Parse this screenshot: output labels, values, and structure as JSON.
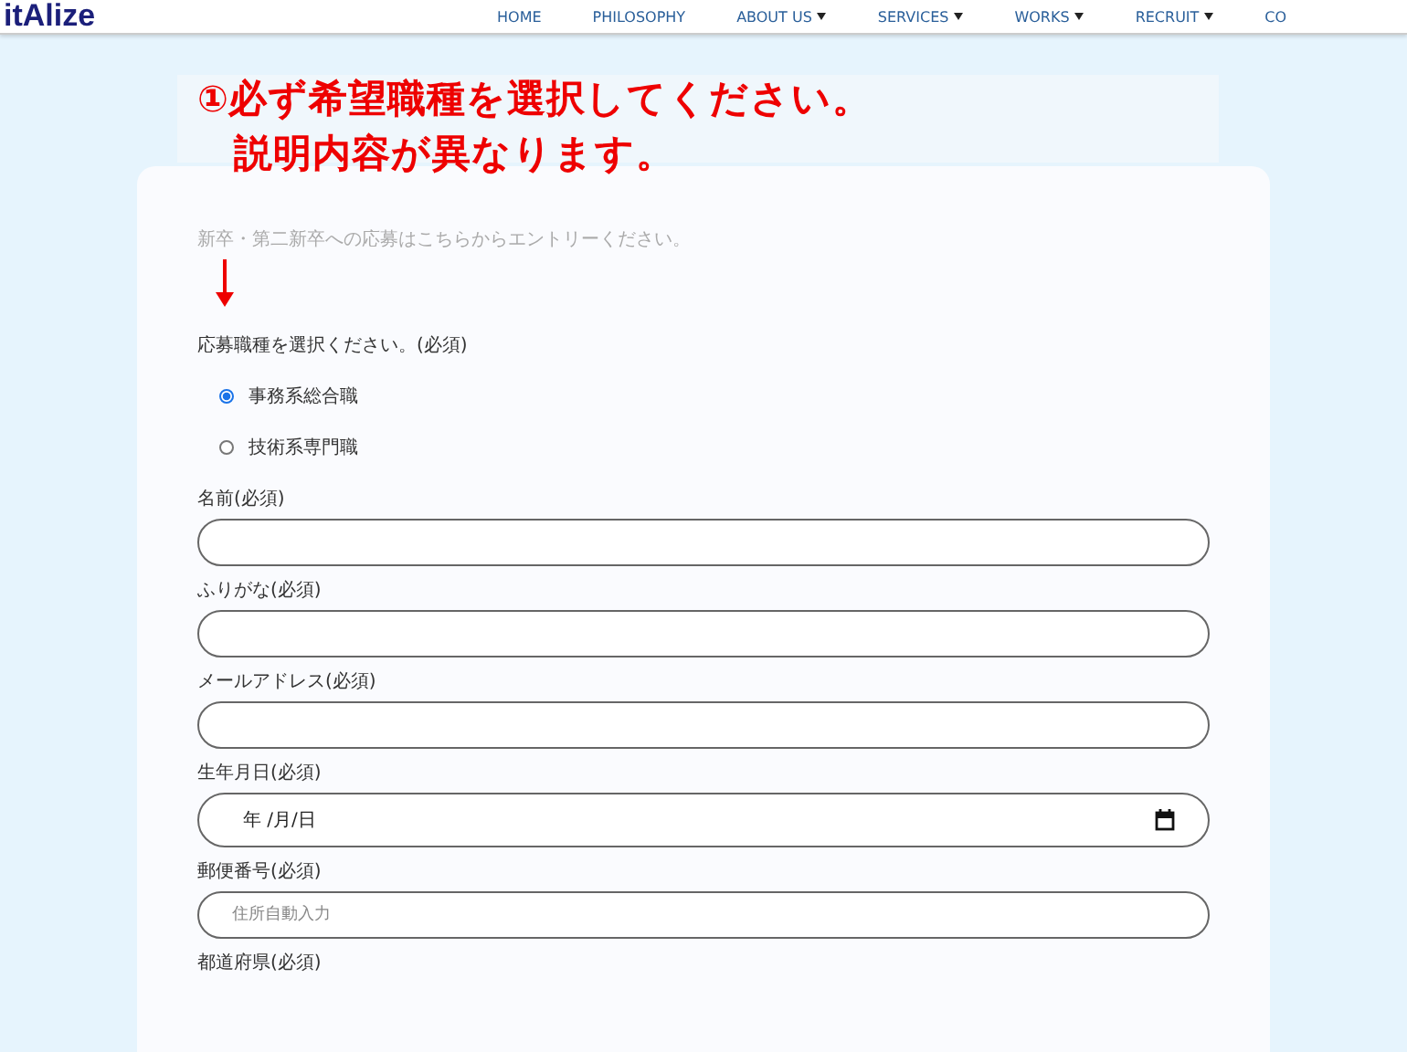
{
  "header": {
    "logo": "itAlize",
    "nav": [
      {
        "label": "HOME",
        "dropdown": false
      },
      {
        "label": "PHILOSOPHY",
        "dropdown": false
      },
      {
        "label": "ABOUT US",
        "dropdown": true
      },
      {
        "label": "SERVICES",
        "dropdown": true
      },
      {
        "label": "WORKS",
        "dropdown": true
      },
      {
        "label": "RECRUIT",
        "dropdown": true
      },
      {
        "label": "CO",
        "dropdown": false
      }
    ]
  },
  "annotation": {
    "number": "①",
    "lines": [
      "必ず希望職種を選択してください。",
      "説明内容が異なります。"
    ]
  },
  "form": {
    "intro": "新卒・第二新卒への応募はこちらからエントリーください。",
    "job_question": "応募職種を選択ください。(必須)",
    "job_options": [
      {
        "label": "事務系総合職",
        "selected": true
      },
      {
        "label": "技術系専門職",
        "selected": false
      }
    ],
    "fields": [
      {
        "label": "名前(必須)",
        "kind": "text"
      },
      {
        "label": "ふりがな(必須)",
        "kind": "text"
      },
      {
        "label": "メールアドレス(必須)",
        "kind": "text"
      },
      {
        "label": "生年月日(必須)",
        "kind": "date",
        "value": "年 /月/日"
      },
      {
        "label": "郵便番号(必須)",
        "kind": "text",
        "placeholder": "住所自動入力"
      },
      {
        "label": "都道府県(必須)",
        "kind": "cut"
      }
    ]
  }
}
